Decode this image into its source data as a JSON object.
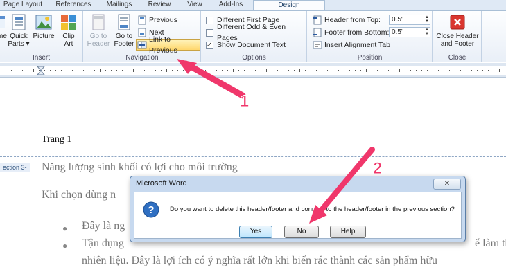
{
  "tabs": [
    "Page Layout",
    "References",
    "Mailings",
    "Review",
    "View",
    "Add-Ins",
    "Design"
  ],
  "insert_group": {
    "label": "Insert",
    "buttons": [
      "me",
      "Quick Parts",
      "Picture",
      "Clip Art"
    ],
    "quick_parts_line1": "Quick",
    "quick_parts_line2": "Parts ▾",
    "clip_line1": "Clip",
    "clip_line2": "Art"
  },
  "navigation_group": {
    "label": "Navigation",
    "goto_header_line1": "Go to",
    "goto_header_line2": "Header",
    "goto_footer_line1": "Go to",
    "goto_footer_line2": "Footer",
    "previous": "Previous",
    "next": "Next",
    "link_to_previous": "Link to Previous"
  },
  "options_group": {
    "label": "Options",
    "items": [
      {
        "label": "Different First Page",
        "checked": false
      },
      {
        "label": "Different Odd & Even Pages",
        "checked": false
      },
      {
        "label": "Show Document Text",
        "checked": true
      }
    ]
  },
  "position_group": {
    "label": "Position",
    "header_from_top_label": "Header from Top:",
    "header_from_top_value": "0.5\"",
    "footer_from_bottom_label": "Footer from Bottom:",
    "footer_from_bottom_value": "0.5\"",
    "insert_alignment_tab": "Insert Alignment Tab"
  },
  "close_group": {
    "label": "Close",
    "close_line1": "Close Header",
    "close_line2": "and Footer"
  },
  "document": {
    "header_text": "Trang 1",
    "section_tag": "ection 3-",
    "heading": "Năng lượng sinh khối có lợi cho môi trường",
    "para": "Khi chọn dùng n",
    "bullet1": "Đây là ng",
    "bullet2_line1": "Tận dụng",
    "bullet2_line2": "nhiên liệu. Đây là lợi ích có ý nghĩa rất lớn khi biến rác thành các sản phẩm hữu",
    "bullet2_tail": "ể làm th"
  },
  "dialog": {
    "title": "Microsoft Word",
    "close_symbol": "✕",
    "message": "Do you want to delete this header/footer and connect to the header/footer in the previous section?",
    "yes": "Yes",
    "no": "No",
    "help": "Help"
  },
  "annotations": {
    "step1": "1",
    "step2": "2",
    "arrow_color": "#f0376b"
  }
}
